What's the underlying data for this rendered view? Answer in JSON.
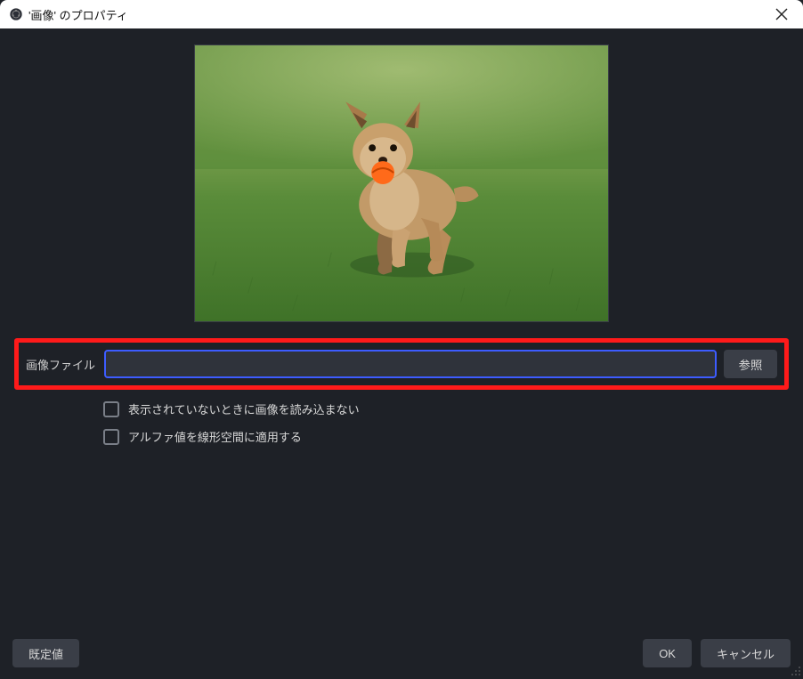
{
  "window": {
    "title": "'画像' のプロパティ"
  },
  "form": {
    "image_file": {
      "label": "画像ファイル",
      "value": "",
      "browse_label": "参照"
    },
    "unload_when_hidden": {
      "label": "表示されていないときに画像を読み込まない",
      "checked": false
    },
    "linear_alpha": {
      "label": "アルファ値を線形空間に適用する",
      "checked": false
    }
  },
  "buttons": {
    "defaults": "既定値",
    "ok": "OK",
    "cancel": "キャンセル"
  }
}
